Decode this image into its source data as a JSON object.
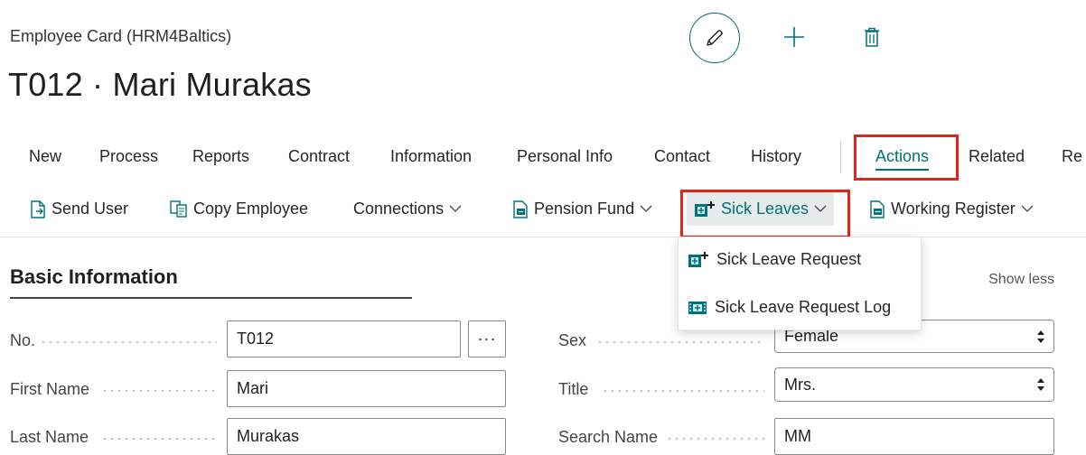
{
  "header": {
    "subtitle": "Employee Card (HRM4Baltics)",
    "title": "T012 · Mari Murakas"
  },
  "toolbar_icons": [
    "pencil-icon",
    "plus-icon",
    "trash-icon"
  ],
  "tabs": [
    {
      "label": "New"
    },
    {
      "label": "Process"
    },
    {
      "label": "Reports"
    },
    {
      "label": "Contract"
    },
    {
      "label": "Information"
    },
    {
      "label": "Personal Info"
    },
    {
      "label": "Contact"
    },
    {
      "label": "History"
    },
    {
      "label": "Actions"
    },
    {
      "label": "Related"
    },
    {
      "label": "Re"
    }
  ],
  "active_tab": "Actions",
  "actions": [
    {
      "label": "Send User",
      "icon": "send-user-icon"
    },
    {
      "label": "Copy Employee",
      "icon": "copy-employee-icon"
    },
    {
      "label": "Connections",
      "icon": "chevron-down-icon"
    },
    {
      "label": "Pension Fund",
      "icon": "pension-fund-icon"
    },
    {
      "label": "Sick Leaves",
      "icon": "sick-leaves-icon"
    },
    {
      "label": "Working Register",
      "icon": "working-register-icon"
    }
  ],
  "dropdown": {
    "items": [
      {
        "label": "Sick Leave Request",
        "icon": "sick-leave-request-icon"
      },
      {
        "label": "Sick Leave Request Log",
        "icon": "sick-leave-log-icon"
      }
    ]
  },
  "section": {
    "title": "Basic Information",
    "toggle": "Show less"
  },
  "fields": {
    "no_label": "No.",
    "no_value": "T012",
    "ellipsis": "···",
    "first_name_label": "First Name",
    "first_name_value": "Mari",
    "last_name_label": "Last Name",
    "last_name_value": "Murakas",
    "sex_label": "Sex",
    "sex_value": "Female",
    "title_label": "Title",
    "title_value": "Mrs.",
    "search_name_label": "Search Name",
    "search_name_value": "MM"
  },
  "colors": {
    "accent": "#00727a",
    "highlight": "#e0261b"
  }
}
